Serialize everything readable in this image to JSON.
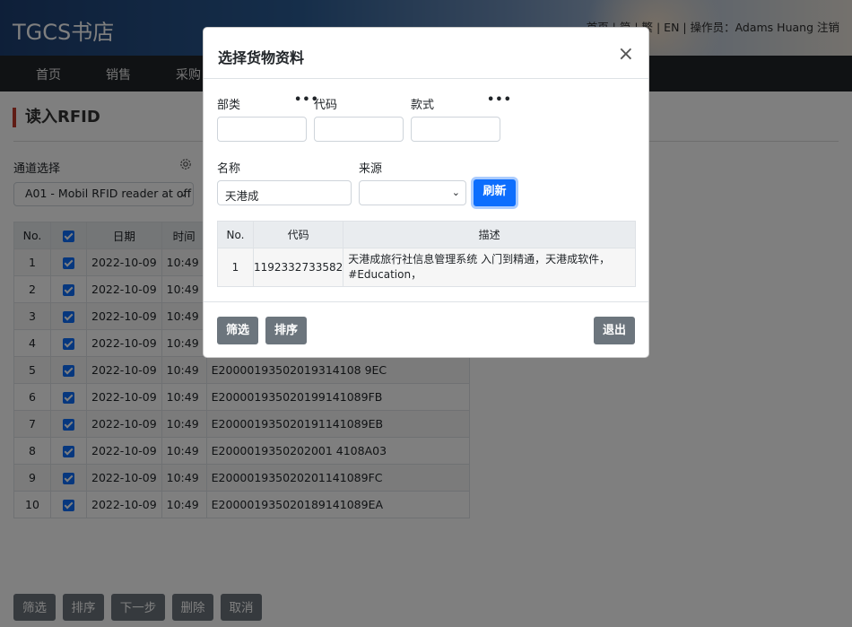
{
  "header": {
    "brand": "TGCS书店",
    "topright": "首页 | 简 | 繁 | EN | 操作员：Adams Huang  注销"
  },
  "nav": [
    "首页",
    "销售",
    "采购"
  ],
  "page": {
    "title": "读入RFID",
    "channel_label": "通道选择",
    "channel_value": "A01 - Mobil RFID reader at off"
  },
  "table": {
    "headers": [
      "No.",
      "日期",
      "时间"
    ],
    "rows": [
      {
        "no": "1",
        "date": "2022-10-09",
        "time": "10:49",
        "code": ""
      },
      {
        "no": "2",
        "date": "2022-10-09",
        "time": "10:49",
        "code": ""
      },
      {
        "no": "3",
        "date": "2022-10-09",
        "time": "10:49",
        "code": ""
      },
      {
        "no": "4",
        "date": "2022-10-09",
        "time": "10:49",
        "code": ""
      },
      {
        "no": "5",
        "date": "2022-10-09",
        "time": "10:49",
        "code": "E20000193502019314108 9EC"
      },
      {
        "no": "6",
        "date": "2022-10-09",
        "time": "10:49",
        "code": "E200001935020199141089FB"
      },
      {
        "no": "7",
        "date": "2022-10-09",
        "time": "10:49",
        "code": "E200001935020191141089EB"
      },
      {
        "no": "8",
        "date": "2022-10-09",
        "time": "10:49",
        "code": "E2000019350202001 4108A03"
      },
      {
        "no": "9",
        "date": "2022-10-09",
        "time": "10:49",
        "code": "E200001935020201141089FC"
      },
      {
        "no": "10",
        "date": "2022-10-09",
        "time": "10:49",
        "code": "E200001935020189141089EA"
      }
    ]
  },
  "bottom_buttons": [
    "筛选",
    "排序",
    "下一步",
    "删除",
    "取消"
  ],
  "modal": {
    "title": "选择货物资料",
    "close": "×",
    "label_dept": "部类",
    "label_code": "代码",
    "label_style": "款式",
    "label_name": "名称",
    "label_source": "来源",
    "name_value": "天港成",
    "refresh": "刷新",
    "table_headers": [
      "No.",
      "代码",
      "描述"
    ],
    "table_rows": [
      {
        "no": "1",
        "code": "1192332733582",
        "desc": "天港成旅行社信息管理系统 入门到精通，天港成软件，#Education，"
      }
    ],
    "btn_filter": "筛选",
    "btn_sort": "排序",
    "btn_exit": "退出"
  }
}
